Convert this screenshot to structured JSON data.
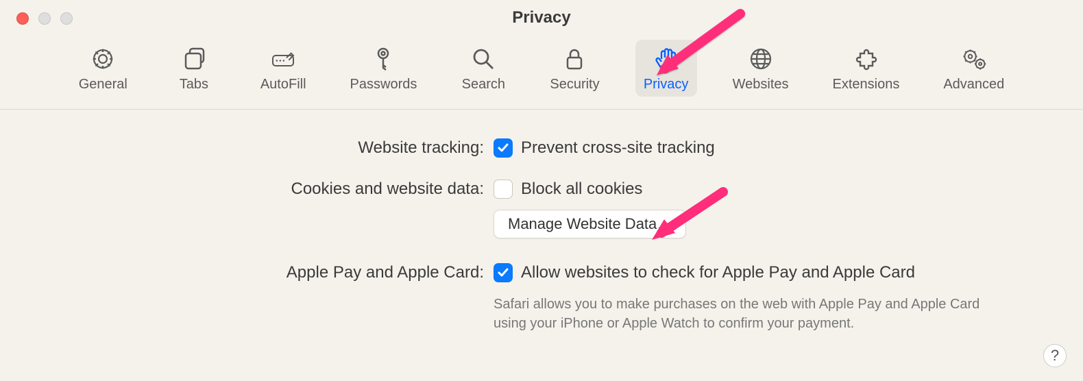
{
  "window": {
    "title": "Privacy"
  },
  "tabs": [
    {
      "id": "general",
      "label": "General"
    },
    {
      "id": "tabs",
      "label": "Tabs"
    },
    {
      "id": "autofill",
      "label": "AutoFill"
    },
    {
      "id": "passwords",
      "label": "Passwords"
    },
    {
      "id": "search",
      "label": "Search"
    },
    {
      "id": "security",
      "label": "Security"
    },
    {
      "id": "privacy",
      "label": "Privacy",
      "selected": true
    },
    {
      "id": "websites",
      "label": "Websites"
    },
    {
      "id": "extensions",
      "label": "Extensions"
    },
    {
      "id": "advanced",
      "label": "Advanced"
    }
  ],
  "sections": {
    "tracking": {
      "label": "Website tracking:",
      "prevent_label": "Prevent cross-site tracking",
      "prevent_checked": true
    },
    "cookies": {
      "label": "Cookies and website data:",
      "block_label": "Block all cookies",
      "block_checked": false,
      "manage_button": "Manage Website Data…"
    },
    "applepay": {
      "label": "Apple Pay and Apple Card:",
      "allow_label": "Allow websites to check for Apple Pay and Apple Card",
      "allow_checked": true,
      "description": "Safari allows you to make purchases on the web with Apple Pay and Apple Card using your iPhone or Apple Watch to confirm your payment."
    }
  },
  "help_label": "?"
}
